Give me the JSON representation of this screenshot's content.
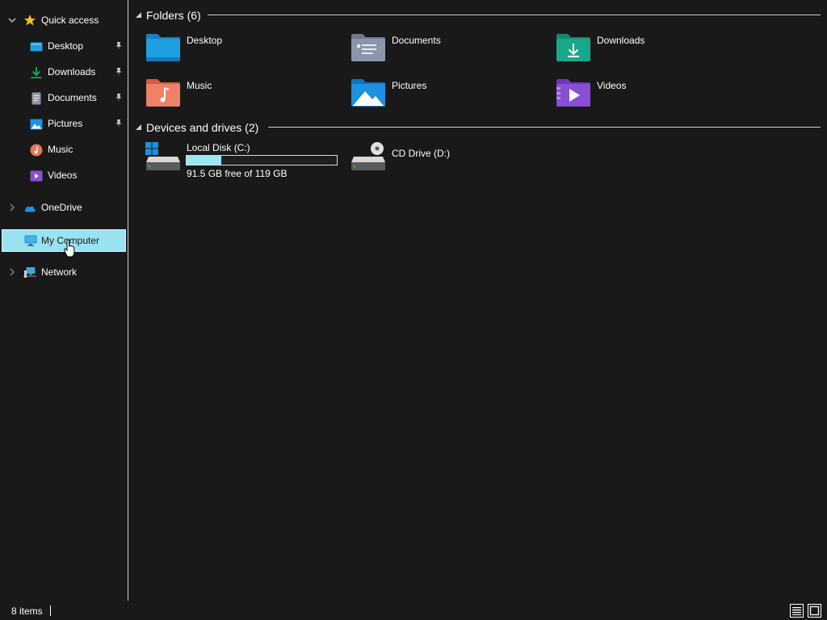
{
  "sidebar": {
    "quick_access": {
      "label": "Quick access",
      "icon": "star-icon"
    },
    "items": [
      {
        "label": "Desktop",
        "icon": "desktop-folder-icon",
        "pinned": true
      },
      {
        "label": "Downloads",
        "icon": "download-arrow-icon",
        "pinned": true
      },
      {
        "label": "Documents",
        "icon": "document-icon",
        "pinned": true
      },
      {
        "label": "Pictures",
        "icon": "picture-icon",
        "pinned": true
      },
      {
        "label": "Music",
        "icon": "music-note-icon",
        "pinned": false
      },
      {
        "label": "Videos",
        "icon": "video-icon",
        "pinned": false
      }
    ],
    "onedrive": {
      "label": "OneDrive",
      "icon": "cloud-icon"
    },
    "my_computer": {
      "label": "My Computer",
      "icon": "monitor-icon",
      "selected": true
    },
    "network": {
      "label": "Network",
      "icon": "network-icon"
    }
  },
  "main": {
    "folders_group": {
      "title": "Folders (6)"
    },
    "folders": [
      {
        "label": "Desktop",
        "icon": "desktop-folder-icon",
        "color": "#1e9fe0"
      },
      {
        "label": "Documents",
        "icon": "documents-folder-icon",
        "color": "#8a97ab"
      },
      {
        "label": "Downloads",
        "icon": "downloads-folder-icon",
        "color": "#1aa88a"
      },
      {
        "label": "Music",
        "icon": "music-folder-icon",
        "color": "#e8765a"
      },
      {
        "label": "Pictures",
        "icon": "pictures-folder-icon",
        "color": "#1e90e0"
      },
      {
        "label": "Videos",
        "icon": "videos-folder-icon",
        "color": "#8a4fd8"
      }
    ],
    "drives_group": {
      "title": "Devices and drives (2)"
    },
    "drives": [
      {
        "label": "Local Disk (C:)",
        "free_text": "91.5 GB free of 119 GB",
        "used_fraction": 0.23,
        "icon": "local-disk-icon"
      },
      {
        "label": "CD Drive (D:)",
        "icon": "cd-drive-icon"
      }
    ]
  },
  "statusbar": {
    "item_count": "8 items"
  },
  "colors": {
    "background": "#191919",
    "selection": "#99e3f0",
    "usage_fill": "#9be6f3"
  }
}
